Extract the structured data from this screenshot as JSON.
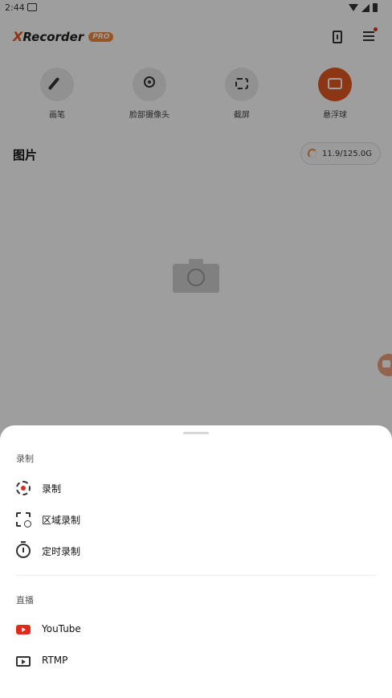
{
  "status_bar": {
    "time": "2:44"
  },
  "app": {
    "logo_x": "X",
    "logo_name": "Recorder",
    "pro_badge": "PRO"
  },
  "quick_tools": [
    {
      "label": "画笔",
      "icon": "brush-icon"
    },
    {
      "label": "脸部摄像头",
      "icon": "face-camera-icon"
    },
    {
      "label": "截屏",
      "icon": "screenshot-icon"
    },
    {
      "label": "悬浮球",
      "icon": "floating-ball-icon"
    }
  ],
  "images": {
    "title": "图片",
    "storage": "11.9/125.0G"
  },
  "sheet": {
    "record_group_title": "录制",
    "record_items": [
      {
        "label": "录制",
        "icon": "record-icon"
      },
      {
        "label": "区域录制",
        "icon": "area-record-icon"
      },
      {
        "label": "定时录制",
        "icon": "timer-icon"
      }
    ],
    "live_group_title": "直播",
    "live_items": [
      {
        "label": "YouTube",
        "icon": "youtube-icon"
      },
      {
        "label": "RTMP",
        "icon": "tv-icon"
      }
    ]
  },
  "colors": {
    "accent": "#e2571f",
    "record_red": "#e02a1a",
    "youtube_red": "#e02a1a"
  }
}
